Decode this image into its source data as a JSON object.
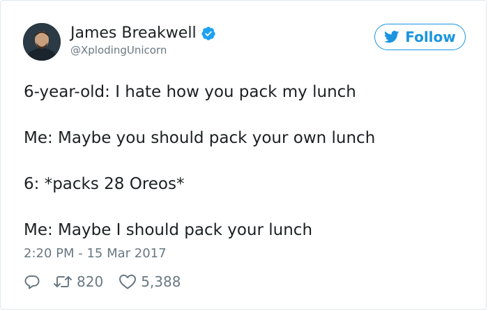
{
  "author": {
    "display_name": "James Breakwell",
    "handle": "@XplodingUnicorn",
    "verified": true,
    "avatar_icon": "profile-photo"
  },
  "follow_button": {
    "label": "Follow",
    "icon": "twitter-bird-icon",
    "color": "#1b95e0"
  },
  "tweet": {
    "lines": [
      "6-year-old: I hate how you pack my lunch",
      "Me: Maybe you should pack your own lunch",
      "6: *packs 28 Oreos*",
      "Me: Maybe I should pack your lunch"
    ],
    "timestamp": "2:20 PM - 15 Mar 2017"
  },
  "actions": {
    "reply": {
      "icon": "reply-icon"
    },
    "retweet": {
      "icon": "retweet-icon",
      "count": "820"
    },
    "like": {
      "icon": "heart-icon",
      "count": "5,388"
    }
  },
  "colors": {
    "text": "#1c2022",
    "secondary": "#697882",
    "accent": "#1b95e0",
    "border": "#e1e8ed"
  }
}
